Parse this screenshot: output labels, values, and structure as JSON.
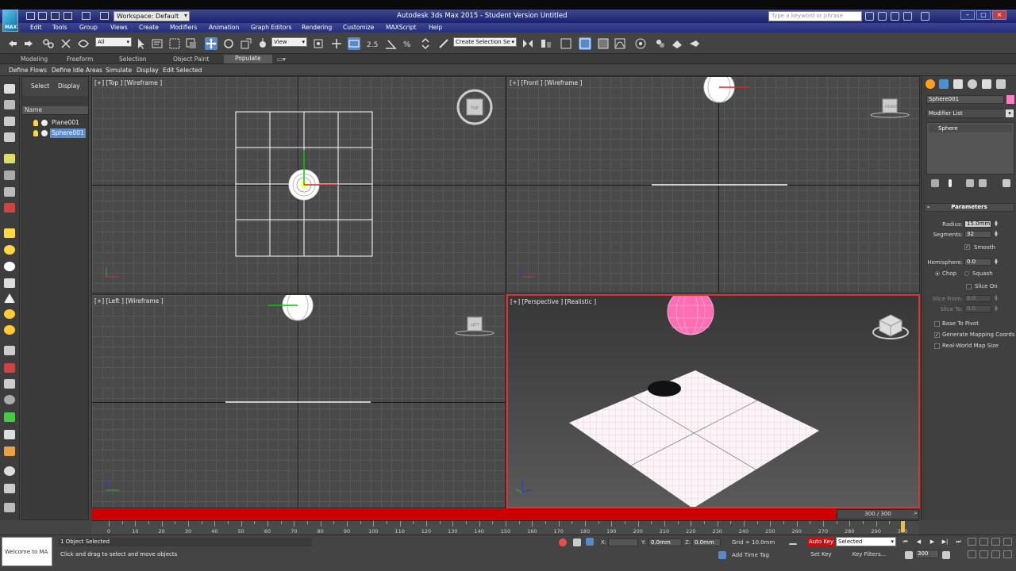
{
  "app": {
    "title": "Autodesk 3ds Max  2015    -  Student Version    Untitled",
    "workspace": "Workspace: Default",
    "search_placeholder": "Type a keyword or phrase",
    "logo_text": "MAX"
  },
  "menu": [
    "Edit",
    "Tools",
    "Group",
    "Views",
    "Create",
    "Modifiers",
    "Animation",
    "Graph Editors",
    "Rendering",
    "Customize",
    "MAXScript",
    "Help"
  ],
  "toolbar": {
    "selection_filter": "All",
    "reference_coord": "View",
    "named_selection": "Create Selection Se",
    "snap_label": "2.5"
  },
  "ribbon": {
    "tabs": [
      "Modeling",
      "Freeform",
      "Selection",
      "Object Paint",
      "Populate"
    ],
    "active_tab": "Populate",
    "sub_items": [
      "Define Flows",
      "Define Idle Areas",
      "Simulate",
      "Display",
      "Edit Selected"
    ]
  },
  "explorer": {
    "tabs": [
      "Select",
      "Display"
    ],
    "column_header": "Name",
    "rows": [
      {
        "name": "Plane001",
        "selected": false
      },
      {
        "name": "Sphere001",
        "selected": true
      }
    ]
  },
  "viewports": {
    "top": "[+] [Top ] [Wireframe ]",
    "front": "[+] [Front ] [Wireframe ]",
    "left": "[+] [Left ] [Wireframe ]",
    "perspective": "[+] [Perspective ] [Realistic ]",
    "cube_top": "TOP",
    "cube_front": "FRONT",
    "cube_left": "LEFT"
  },
  "command_panel": {
    "object_name": "Sphere001",
    "object_color": "#ff7fbf",
    "modifier_list": "Modifier List",
    "stack_item": "Sphere",
    "rollout_title": "Parameters",
    "radius_label": "Radius:",
    "radius_value": "15.0mm",
    "segments_label": "Segments:",
    "segments_value": "32",
    "smooth_label": "Smooth",
    "hemisphere_label": "Hemisphere:",
    "hemisphere_value": "0.0",
    "chop_label": "Chop",
    "squash_label": "Squash",
    "slice_on_label": "Slice On",
    "slice_from_label": "Slice From:",
    "slice_from_value": "0.0",
    "slice_to_label": "Slice To:",
    "slice_to_value": "0.0",
    "base_to_pivot_label": "Base To Pivot",
    "gen_mapping_label": "Generate Mapping Coords",
    "real_world_label": "Real-World Map Size"
  },
  "timeline": {
    "frame_display": "300 / 300",
    "prev": "<",
    "next": ">",
    "current_frame": 300,
    "max_frame": 300,
    "labels": [
      "0",
      "10",
      "20",
      "30",
      "40",
      "50",
      "60",
      "70",
      "80",
      "90",
      "100",
      "110",
      "120",
      "130",
      "140",
      "150",
      "160",
      "170",
      "180",
      "190",
      "200",
      "210",
      "220",
      "230",
      "240",
      "250",
      "260",
      "270",
      "280",
      "290",
      "300"
    ]
  },
  "status": {
    "maxscript": "Welcome to MA",
    "selection": "1 Object Selected",
    "prompt": "Click and drag to select and move objects",
    "x_label": "X:",
    "x_value": "",
    "y_label": "Y:",
    "y_value": "0.0mm",
    "z_label": "Z:",
    "z_value": "0.0mm",
    "grid": "Grid = 10.0mm",
    "add_time_tag": "Add Time Tag",
    "auto_key": "Auto Key",
    "set_key": "Set Key",
    "selected_filter": "Selected",
    "key_filters": "Key Filters...",
    "frame": "300"
  },
  "colors": {
    "accent": "#5b88c8",
    "timeline": "#cc0000",
    "selected_object": "#ff7fbf"
  }
}
